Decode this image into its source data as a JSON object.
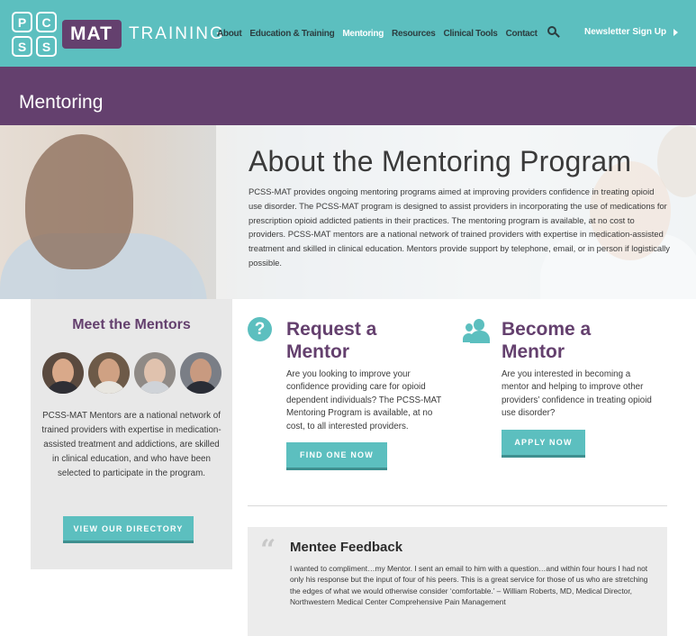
{
  "header": {
    "logo": {
      "letters": [
        "P",
        "C",
        "S",
        "S"
      ],
      "mat": "MAT",
      "training": "TRAINING"
    },
    "nav": [
      {
        "label": "About",
        "active": false
      },
      {
        "label": "Education & Training",
        "active": false
      },
      {
        "label": "Mentoring",
        "active": true
      },
      {
        "label": "Resources",
        "active": false
      },
      {
        "label": "Clinical Tools",
        "active": false
      },
      {
        "label": "Contact",
        "active": false
      }
    ],
    "search_icon": "search-icon",
    "newsletter": "Newsletter Sign Up"
  },
  "page_title": "Mentoring",
  "hero": {
    "heading": "About the Mentoring Program",
    "body": "PCSS-MAT provides ongoing mentoring programs aimed at improving providers confidence in treating opioid use disorder. The PCSS-MAT program is designed to assist providers in incorporating the use of medications for prescription opioid addicted patients in their practices. The mentoring program is available, at no cost to providers. PCSS-MAT mentors are a national network of trained providers with expertise in medication-assisted treatment and skilled in clinical education. Mentors provide support by telephone, email, or in person if logistically possible."
  },
  "sidebar": {
    "heading": "Meet the Mentors",
    "description": "PCSS-MAT Mentors are a national network of trained providers with expertise in medication-assisted treatment and addictions, are skilled in clinical education, and who have been selected to participate in the program.",
    "button": "VIEW OUR DIRECTORY"
  },
  "request": {
    "icon": "question-icon",
    "icon_glyph": "?",
    "heading_line1": "Request a",
    "heading_line2": "Mentor",
    "body": "Are you looking to improve your confidence providing care for opioid dependent individuals? The PCSS-MAT Mentoring Program is available, at no cost, to all interested providers.",
    "button": "FIND ONE NOW"
  },
  "become": {
    "icon": "people-icon",
    "heading_line1": "Become a",
    "heading_line2": "Mentor",
    "body": "Are you interested in becoming a mentor and helping to improve other providers’ confidence in treating opioid use disorder?",
    "button": "APPLY NOW"
  },
  "feedback": {
    "quote_glyph": "“",
    "heading": "Mentee Feedback",
    "body": "I wanted to compliment…my Mentor. I sent an email to him with a question…and within four hours I had not only his response but the input of four of his peers. This is a great service for those of us who are stretching the edges of what we would otherwise consider ‘comfortable.’ – William Roberts, MD, Medical Director, Northwestern Medical Center Comprehensive Pain Management"
  },
  "colors": {
    "teal": "#5cbfbf",
    "purple": "#64406e",
    "panel_gray": "#e8e8e8"
  }
}
